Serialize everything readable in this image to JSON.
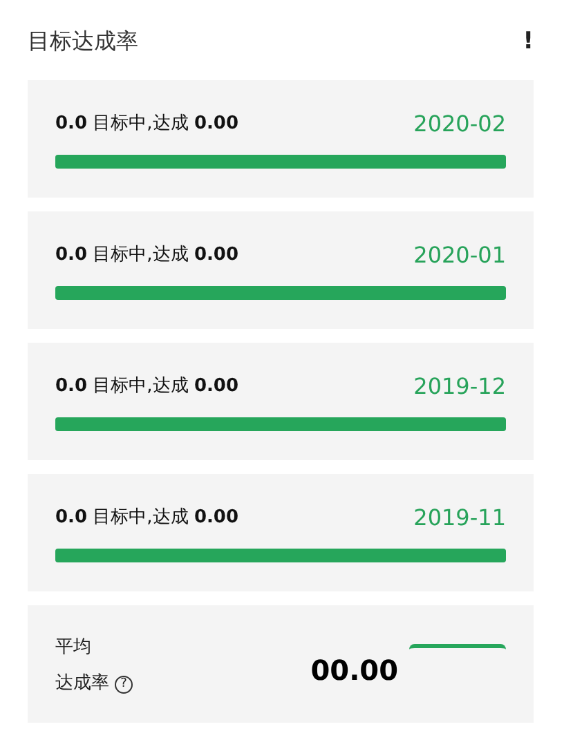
{
  "title": "目标达成率",
  "alert_icon": "!",
  "months": [
    {
      "summary": "**0.0** 目标中,达成 **0.00**",
      "date": "2020-02",
      "level": 1
    },
    {
      "summary": "**0.0** 目标中,达成 **0.00**",
      "date": "2020-01",
      "level": 1
    },
    {
      "summary": "**0.0** 目标中,达成 **0.00**",
      "date": "2019-12",
      "level": 1
    },
    {
      "summary": "**0.0** 目标中,达成 **0.00**",
      "date": "2019-11",
      "level": 1
    }
  ],
  "average": {
    "label_line_1": "平均",
    "label_line_2": "达成率",
    "help_icon": "?",
    "value": "00.00"
  }
}
